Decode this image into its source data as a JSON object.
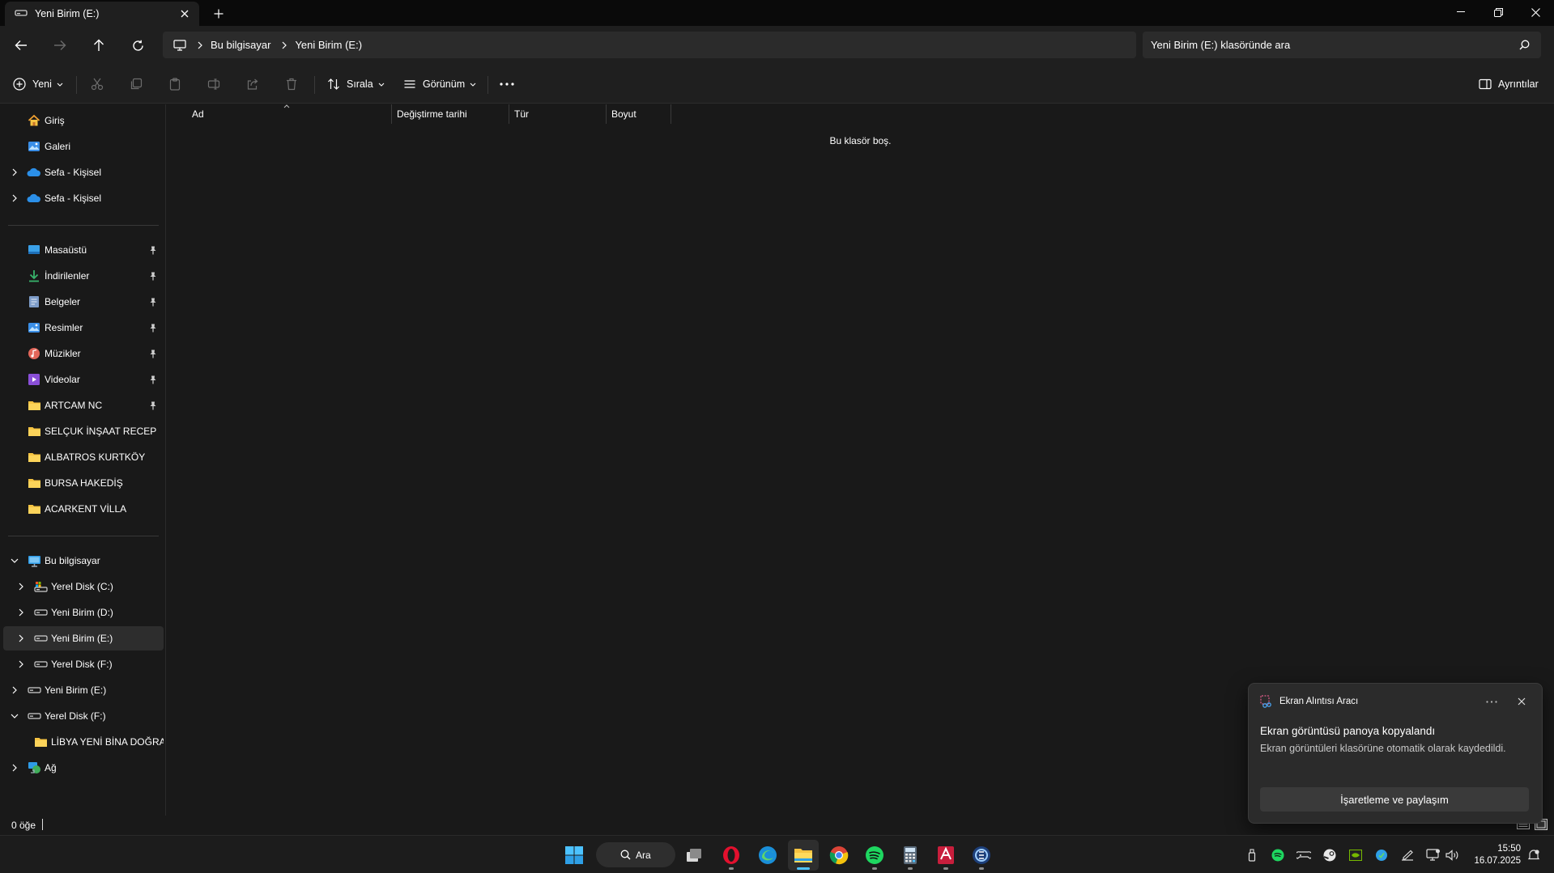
{
  "window": {
    "tab_title": "Yeni Birim (E:)",
    "new_tab_label": "+"
  },
  "nav": {
    "breadcrumb": [
      "Bu bilgisayar",
      "Yeni Birim (E:)"
    ],
    "search_placeholder": "Yeni Birim (E:) klasöründe ara"
  },
  "commands": {
    "new": "Yeni",
    "sort": "Sırala",
    "view": "Görünüm",
    "more": "•••",
    "details": "Ayrıntılar"
  },
  "sidebar": {
    "top": [
      {
        "label": "Giriş",
        "icon": "home-icon"
      },
      {
        "label": "Galeri",
        "icon": "gallery-icon"
      },
      {
        "label": "Sefa - Kişisel",
        "icon": "onedrive-icon"
      },
      {
        "label": "Sefa - Kişisel",
        "icon": "onedrive-icon"
      }
    ],
    "quick": [
      {
        "label": "Masaüstü",
        "icon": "desktop-icon"
      },
      {
        "label": "İndirilenler",
        "icon": "download-icon"
      },
      {
        "label": "Belgeler",
        "icon": "documents-icon"
      },
      {
        "label": "Resimler",
        "icon": "pictures-icon"
      },
      {
        "label": "Müzikler",
        "icon": "music-icon"
      },
      {
        "label": "Videolar",
        "icon": "videos-icon"
      },
      {
        "label": "ARTCAM NC",
        "icon": "folder-icon"
      },
      {
        "label": "SELÇUK İNŞAAT RECEP",
        "icon": "folder-icon"
      },
      {
        "label": "ALBATROS KURTKÖY",
        "icon": "folder-icon"
      },
      {
        "label": "BURSA HAKEDİŞ",
        "icon": "folder-icon"
      },
      {
        "label": "ACARKENT VİLLA",
        "icon": "folder-icon"
      }
    ],
    "thispc": {
      "label": "Bu bilgisayar",
      "icon": "computer-icon"
    },
    "drives": [
      {
        "label": "Yerel Disk (C:)",
        "icon": "system-drive-icon"
      },
      {
        "label": "Yeni Birim (D:)",
        "icon": "drive-icon"
      },
      {
        "label": "Yeni Birim (E:)",
        "icon": "drive-icon"
      },
      {
        "label": "Yerel Disk (F:)",
        "icon": "drive-icon"
      }
    ],
    "root_drives": [
      {
        "label": "Yeni Birim (E:)",
        "icon": "drive-icon"
      },
      {
        "label": "Yerel Disk (F:)",
        "icon": "drive-icon"
      }
    ],
    "subfolder": {
      "label": "LİBYA YENİ BİNA DOĞRAM",
      "icon": "folder-icon"
    },
    "network": {
      "label": "Ağ",
      "icon": "network-icon"
    }
  },
  "columns": [
    "Ad",
    "Değiştirme tarihi",
    "Tür",
    "Boyut"
  ],
  "empty_message": "Bu klasör boş.",
  "status": {
    "item_count": "0 öğe"
  },
  "toast": {
    "app_name": "Ekran Alıntısı Aracı",
    "title": "Ekran görüntüsü panoya kopyalandı",
    "body": "Ekran görüntüleri klasörüne otomatik olarak kaydedildi.",
    "action": "İşaretleme ve paylaşım"
  },
  "taskbar": {
    "search_label": "Ara",
    "time": "15:50",
    "date": "16.07.2025"
  },
  "colors": {
    "accent": "#4cc2ff",
    "folder": "#f5c342",
    "background": "#191919"
  }
}
